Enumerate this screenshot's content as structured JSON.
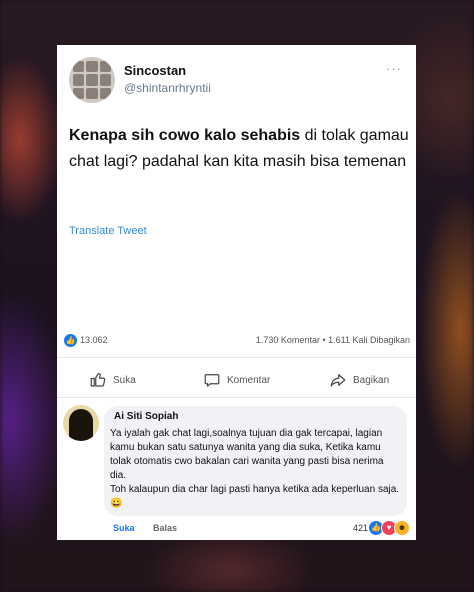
{
  "tweet": {
    "display_name": "Sincostan",
    "handle": "@shintanrhryntii",
    "more_label": "···",
    "text_bold": "Kenapa sih cowo kalo sehabis",
    "text_rest": " di tolak gamau chat lagi? padahal kan kita masih bisa temenan",
    "translate_label": "Translate Tweet"
  },
  "post_stats": {
    "likes": "13.062",
    "comments_shares": "1.730 Komentar • 1.611 Kali Dibagikan"
  },
  "actions": {
    "like_label": "Suka",
    "comment_label": "Komentar",
    "share_label": "Bagikan"
  },
  "comment": {
    "author": "Ai Siti Sopiah",
    "text": "Ya iyalah gak chat lagi,soalnya tujuan dia gak tercapai, lagian kamu bukan satu satunya wanita yang dia suka, Ketika kamu tolak otomatis cwo bakalan cari wanita yang pasti bisa nerima dia.\nToh kalaupun dia char lagi pasti hanya ketika ada keperluan saja. 😀",
    "like_label": "Suka",
    "reply_label": "Balas",
    "reaction_count": "421"
  },
  "colors": {
    "accent_blue": "#1877f2",
    "link_blue": "#3a8bd6",
    "bubble_bg": "#f0f2f5"
  },
  "icons": [
    "avatar",
    "more-icon",
    "like-icon",
    "comment-icon",
    "share-icon",
    "like-reaction-icon",
    "love-reaction-icon",
    "haha-reaction-icon"
  ]
}
